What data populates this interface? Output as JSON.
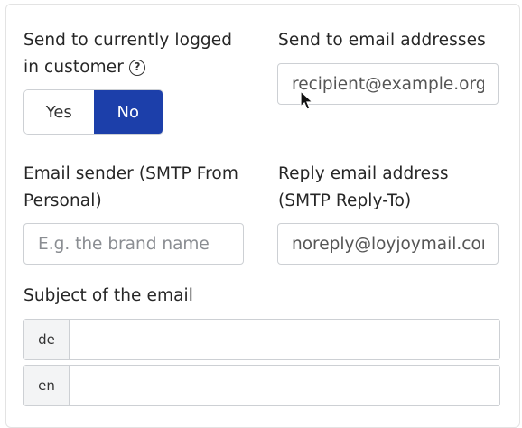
{
  "send_to_customer": {
    "label_line1": "Send to currently logged",
    "label_line2": "in customer",
    "help_icon": "question-circle-icon",
    "options": [
      "Yes",
      "No"
    ],
    "selected": "No"
  },
  "send_to_addresses": {
    "label": "Send to email addresses",
    "value": "recipient@example.org"
  },
  "email_sender": {
    "label_line1": "Email sender (SMTP From",
    "label_line2": "Personal)",
    "placeholder": "E.g. the brand name"
  },
  "reply_address": {
    "label_line1": "Reply email address",
    "label_line2": "(SMTP Reply-To)",
    "value": "noreply@loyjoymail.com"
  },
  "subject": {
    "label": "Subject of the email",
    "languages": [
      {
        "code": "de",
        "value": ""
      },
      {
        "code": "en",
        "value": ""
      }
    ]
  },
  "colors": {
    "accent": "#1c3faa",
    "border": "#cdd0d4"
  }
}
